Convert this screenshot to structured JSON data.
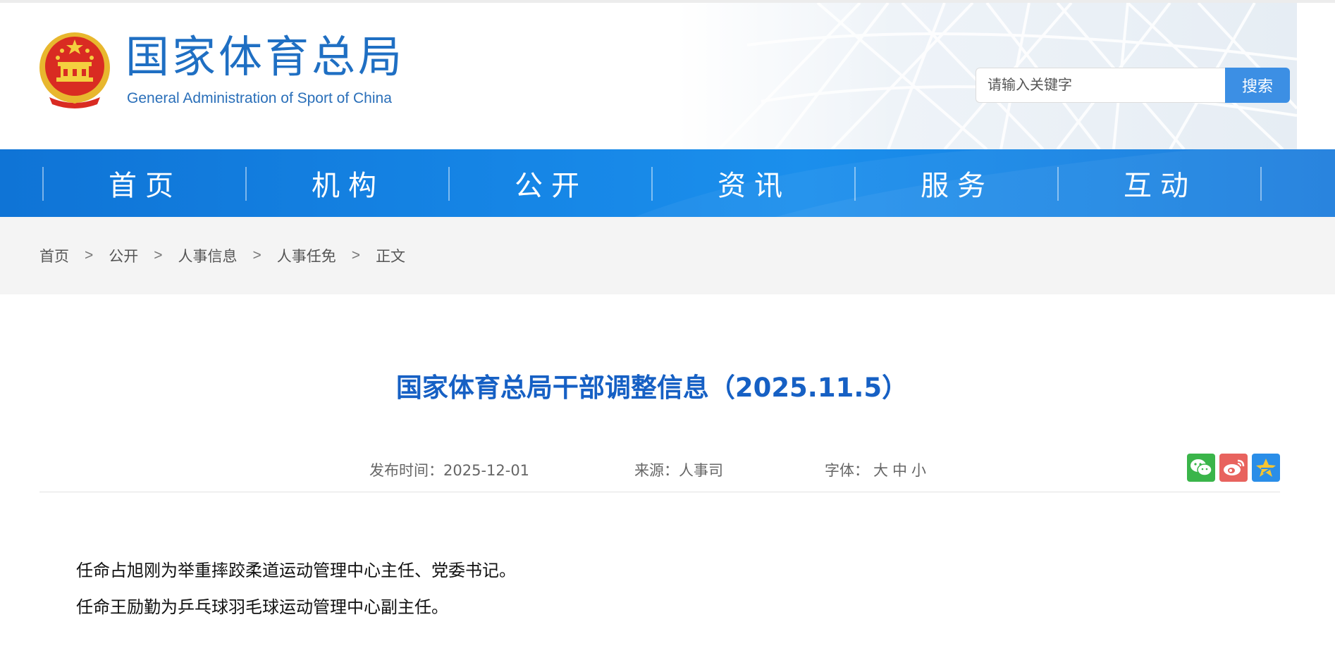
{
  "header": {
    "site_title": "国家体育总局",
    "site_subtitle": "General Administration of Sport of China",
    "search_placeholder": "请输入关键字",
    "search_button": "搜索"
  },
  "nav": {
    "items": [
      {
        "label": "首页"
      },
      {
        "label": "机构"
      },
      {
        "label": "公开"
      },
      {
        "label": "资讯"
      },
      {
        "label": "服务"
      },
      {
        "label": "互动"
      }
    ]
  },
  "breadcrumb": {
    "items": [
      "首页",
      "公开",
      "人事信息",
      "人事任免"
    ],
    "current": "正文",
    "separator": ">"
  },
  "article": {
    "title": "国家体育总局干部调整信息（2025.11.5）",
    "meta": {
      "date_label": "发布时间：",
      "date": "2025-12-01",
      "source_label": "来源：",
      "source": "人事司",
      "font_label": "字体：",
      "font_sizes": [
        "大",
        "中",
        "小"
      ]
    },
    "paragraphs": [
      "任命占旭刚为举重摔跤柔道运动管理中心主任、党委书记。",
      "任命王励勤为乒乓球羽毛球运动管理中心副主任。"
    ]
  },
  "share_icons": [
    "wechat-icon",
    "weibo-icon",
    "qzone-icon"
  ],
  "colors": {
    "brand_blue": "#1f6fc3",
    "nav_blue": "#1686e6",
    "title_blue": "#1660c4",
    "search_button": "#3c8fe4"
  }
}
